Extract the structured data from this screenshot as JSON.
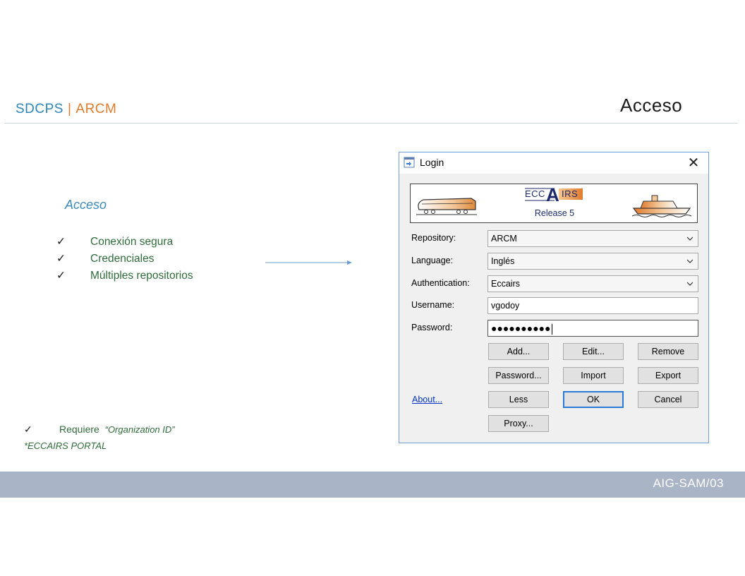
{
  "slide": {
    "brand_part1": "SDCPS",
    "brand_separator": "|",
    "brand_part2": "ARCM",
    "title": "Acceso",
    "section_heading": "Acceso",
    "features": [
      "Conexión  segura",
      "Credenciales",
      "Múltiples  repositorios"
    ],
    "check_glyph": "✓",
    "note_prefix": "Requiere",
    "note_emphasis": "“Organization ID”",
    "portal_note": "*ECCAIRS PORTAL",
    "footer_code": "AIG-SAM/03",
    "colors": {
      "brand_blue": "#2e86b8",
      "brand_orange": "#e07b2c",
      "feature_green": "#2f6b3a",
      "footer_band": "#a9b4c6"
    }
  },
  "dialog": {
    "title": "Login",
    "close_glyph": "✕",
    "logo_text_left": "ECC",
    "logo_text_mid": "A",
    "logo_text_right": "IRS",
    "logo_release": "Release 5",
    "labels": {
      "repository": "Repository:",
      "language": "Language:",
      "authentication": "Authentication:",
      "username": "Username:",
      "password": "Password:"
    },
    "values": {
      "repository": "ARCM",
      "language": "Inglés",
      "authentication": "Eccairs",
      "username": "vgodoy",
      "password_masked": "●●●●●●●●●●"
    },
    "buttons": {
      "add": "Add...",
      "edit": "Edit...",
      "remove": "Remove",
      "password": "Password...",
      "import": "Import",
      "export": "Export",
      "less": "Less",
      "ok": "OK",
      "cancel": "Cancel",
      "proxy": "Proxy..."
    },
    "about_link": "About...",
    "icons": {
      "title": "login-window-icon",
      "close": "close-icon",
      "dropdown": "chevron-down-icon",
      "banner_left": "train-icon",
      "banner_right": "ship-icon"
    }
  }
}
